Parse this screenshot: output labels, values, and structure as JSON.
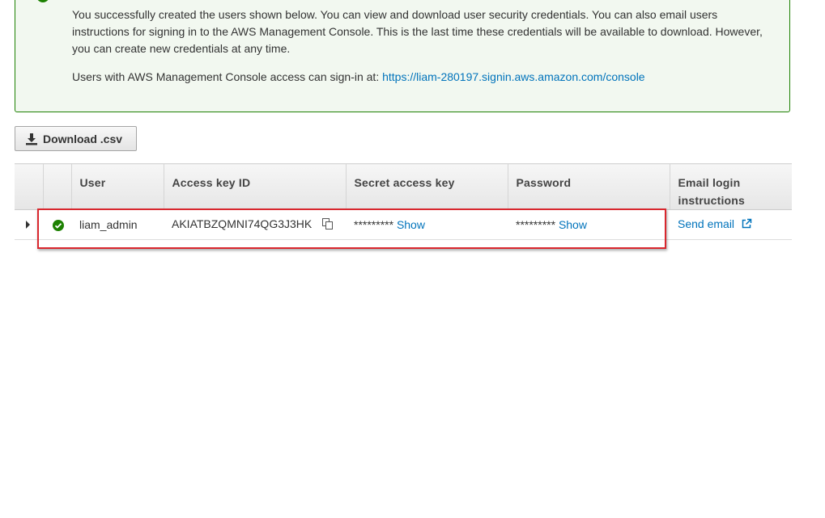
{
  "alert": {
    "message": "You successfully created the users shown below. You can view and download user security credentials. You can also email users instructions for signing in to the AWS Management Console. This is the last time these credentials will be available to download. However, you can create new credentials at any time.",
    "signin_prefix": "Users with AWS Management Console access can sign-in at:",
    "signin_url": "https://liam-280197.signin.aws.amazon.com/console"
  },
  "toolbar": {
    "download_label": "Download .csv",
    "download_icon": "download-icon"
  },
  "table": {
    "headers": [
      "",
      "",
      "User",
      "Access key ID",
      "Secret access key",
      "Password",
      "Email login instructions"
    ],
    "rows": [
      {
        "status_icon": "success-check-icon",
        "user": "liam_admin",
        "access_key_id": "AKIATBZQMNI74QG3J3HK",
        "secret_mask": "*********",
        "secret_show": "Show",
        "password_mask": "*********",
        "password_show": "Show",
        "email_action": "Send email"
      }
    ]
  },
  "colors": {
    "success": "#1d8102",
    "link": "#0073bb",
    "highlight": "#d9272e"
  }
}
